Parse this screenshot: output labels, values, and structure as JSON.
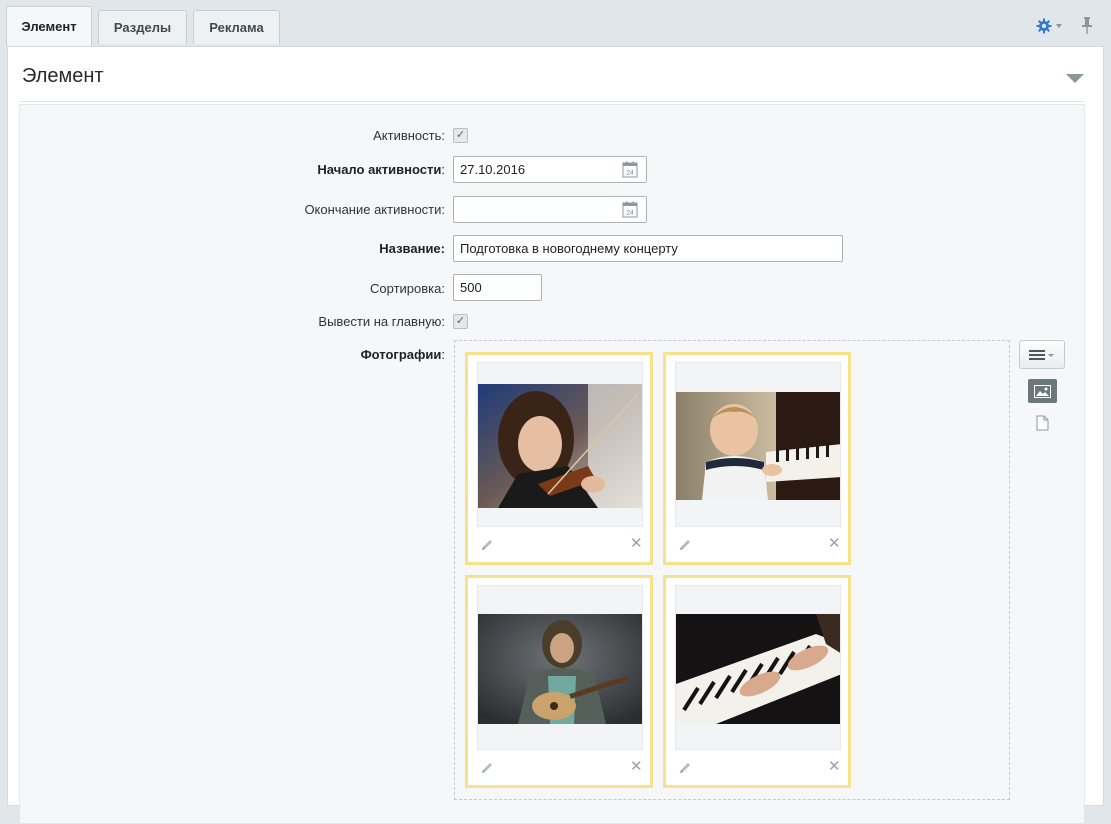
{
  "tabs": [
    {
      "label": "Элемент",
      "active": true
    },
    {
      "label": "Разделы",
      "active": false
    },
    {
      "label": "Реклама",
      "active": false
    }
  ],
  "toolbar": {
    "settings_icon": "gear-icon",
    "pin_icon": "pin-icon"
  },
  "section": {
    "title": "Элемент"
  },
  "form": {
    "active_label": "Активность:",
    "active_checked": true,
    "start_label": "Начало активности",
    "start_value": "27.10.2016",
    "end_label": "Окончание активности:",
    "end_value": "",
    "calendar_day": "24",
    "name_label": "Название:",
    "name_value": "Подготовка в новогоднему концерту",
    "sort_label": "Сортировка:",
    "sort_value": "500",
    "main_page_label": "Вывести на главную:",
    "main_page_checked": true,
    "photos_label": "Фотографии"
  },
  "photos": [
    {
      "subject": "woman-playing-violin"
    },
    {
      "subject": "child-at-piano"
    },
    {
      "subject": "man-playing-guitar"
    },
    {
      "subject": "hands-on-piano-keys"
    }
  ],
  "colors": {
    "card_border": "#f5e28a",
    "accent_gear": "#2f7ad0"
  }
}
